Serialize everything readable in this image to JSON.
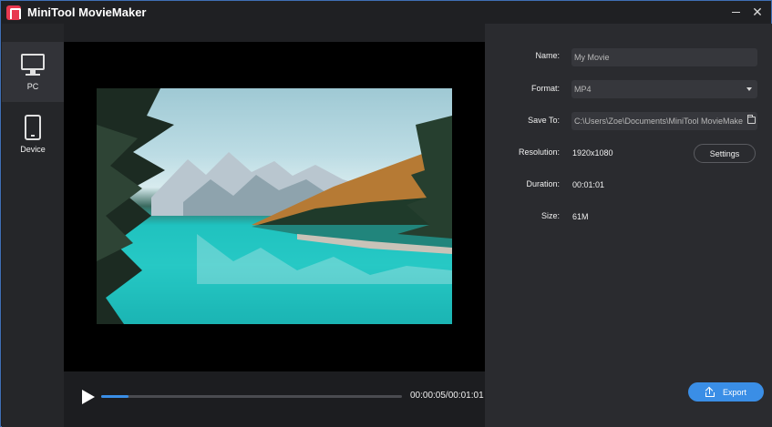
{
  "window": {
    "title": "MiniTool MovieMaker",
    "minimize_icon": "minimize-icon",
    "close_glyph": "✕"
  },
  "sidebar": {
    "items": [
      {
        "label": "PC",
        "icon": "monitor-icon",
        "selected": true
      },
      {
        "label": "Device",
        "icon": "phone-icon",
        "selected": false
      }
    ]
  },
  "player": {
    "time": "00:00:05/00:01:01",
    "progress": 0.09,
    "play_icon": "play-icon"
  },
  "export_settings": {
    "name_label": "Name:",
    "name_value": "My Movie",
    "format_label": "Format:",
    "format_value": "MP4",
    "save_to_label": "Save To:",
    "save_to_value": "C:\\Users\\Zoe\\Documents\\MiniTool MovieMake",
    "resolution_label": "Resolution:",
    "resolution_value": "1920x1080",
    "settings_button": "Settings",
    "duration_label": "Duration:",
    "duration_value": "00:01:01",
    "size_label": "Size:",
    "size_value": "61M"
  },
  "export_button": "Export",
  "colors": {
    "accent": "#3a8ee6",
    "background": "#1f2023",
    "panel": "#2a2b2f"
  }
}
